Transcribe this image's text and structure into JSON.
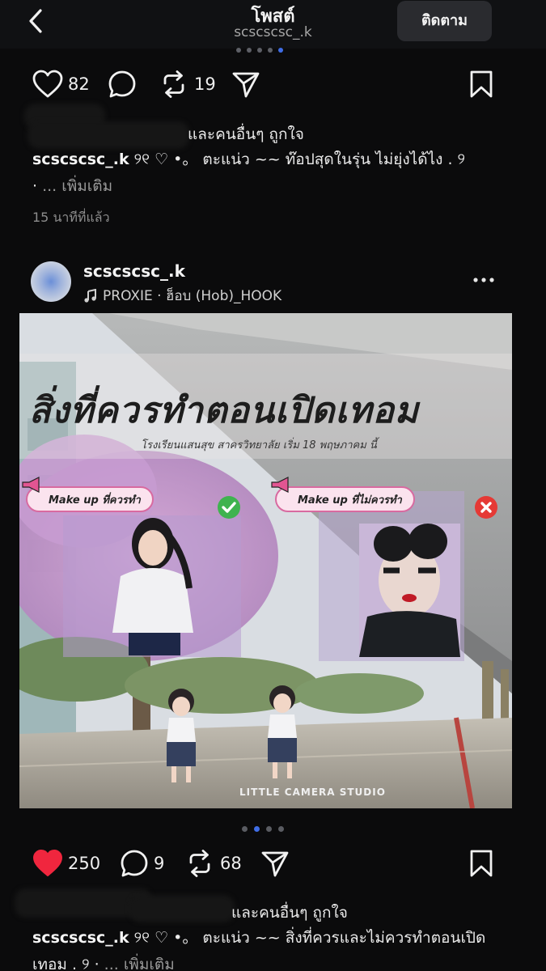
{
  "header": {
    "title": "โพสต์",
    "subtitle": "scscscsc_.k",
    "follow_label": "ติดตาม"
  },
  "post1": {
    "likes": "82",
    "reposts": "19",
    "liked_by_suffix": "และคนอื่นๆ ถูกใจ",
    "caption_user": "scscscsc_.k",
    "caption_text": " ୨୧ ♡ •。 ตะแน่ว ~~ ท๊อปสุดในรุ่น ไม่ยุ่งได้ไง . ୨",
    "caption_text2": "· ",
    "more_label": "... เพิ่มเติม",
    "time": "15 นาทีที่แล้ว"
  },
  "post2": {
    "username": "scscscsc_.k",
    "music": "PROXIE · ฮ็อบ (Hob)_HOOK",
    "image": {
      "title": "สิ่งที่ควรทำตอนเปิดเทอม",
      "subtitle": "โรงเรียนแสนสุข  สาครวิทยาลัย  เริ่ม 18  พฤษภาคม  นี้",
      "tag_left": "Make up ที่ควรทำ",
      "tag_right": "Make up ที่ไม่ควรทำ",
      "watermark": "LITTLE CAMERA STUDIO"
    },
    "likes": "250",
    "comments": "9",
    "reposts": "68",
    "liked_by_suffix": "และคนอื่นๆ ถูกใจ",
    "caption_user": "scscscsc_.k",
    "caption_text": " ୨୧ ♡ •。 ตะแน่ว ~~ สิ่งที่ควรและไม่ควรทำตอนเปิดเทอม . ୨ · ",
    "more_label": "... เพิ่มเติม"
  },
  "colors": {
    "background": "#0b0b0c",
    "accent_dot": "#3f6de6",
    "like_red": "#f0263e"
  },
  "icons": [
    "back-icon",
    "heart-icon",
    "comment-icon",
    "repost-icon",
    "share-icon",
    "bookmark-icon",
    "music-note-icon",
    "more-icon",
    "megaphone-icon",
    "check-icon",
    "x-icon"
  ]
}
